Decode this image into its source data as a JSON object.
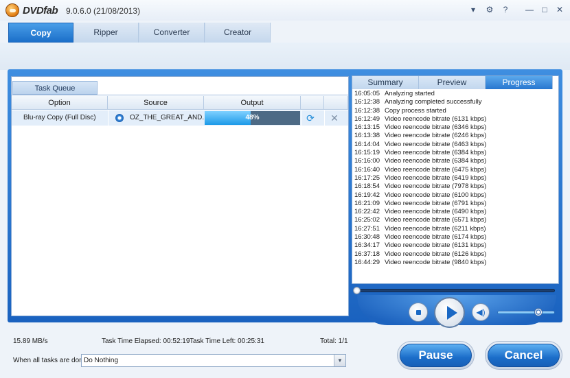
{
  "window": {
    "brand": "DVDfab",
    "version": "9.0.6.0 (21/08/2013)",
    "controls": [
      "▾",
      "⚙",
      "?",
      "—",
      "□",
      "✕"
    ]
  },
  "tabs": [
    {
      "label": "Copy",
      "active": true
    },
    {
      "label": "Ripper",
      "active": false
    },
    {
      "label": "Converter",
      "active": false
    },
    {
      "label": "Creator",
      "active": false
    }
  ],
  "queue": {
    "tab_label": "Task Queue",
    "headers": {
      "option": "Option",
      "source": "Source",
      "output": "Output"
    },
    "rows": [
      {
        "option": "Blu-ray Copy (Full Disc)",
        "source": "OZ_THE_GREAT_AND...",
        "output_progress": 48,
        "output_text": "48%"
      }
    ]
  },
  "right_tabs": [
    {
      "label": "Summary",
      "active": false
    },
    {
      "label": "Preview",
      "active": false
    },
    {
      "label": "Progress",
      "active": true
    }
  ],
  "log": [
    {
      "time": "16:05:05",
      "text": "Analyzing started"
    },
    {
      "time": "16:12:38",
      "text": "Analyzing completed successfully"
    },
    {
      "time": "16:12:38",
      "text": "Copy process started"
    },
    {
      "time": "16:12:49",
      "text": "Video reencode bitrate (6131 kbps)"
    },
    {
      "time": "16:13:15",
      "text": "Video reencode bitrate (6346 kbps)"
    },
    {
      "time": "16:13:38",
      "text": "Video reencode bitrate (6246 kbps)"
    },
    {
      "time": "16:14:04",
      "text": "Video reencode bitrate (6463 kbps)"
    },
    {
      "time": "16:15:19",
      "text": "Video reencode bitrate (6384 kbps)"
    },
    {
      "time": "16:16:00",
      "text": "Video reencode bitrate (6384 kbps)"
    },
    {
      "time": "16:16:40",
      "text": "Video reencode bitrate (6475 kbps)"
    },
    {
      "time": "16:17:25",
      "text": "Video reencode bitrate (6419 kbps)"
    },
    {
      "time": "16:18:54",
      "text": "Video reencode bitrate (7978 kbps)"
    },
    {
      "time": "16:19:42",
      "text": "Video reencode bitrate (6100 kbps)"
    },
    {
      "time": "16:21:09",
      "text": "Video reencode bitrate (6791 kbps)"
    },
    {
      "time": "16:22:42",
      "text": "Video reencode bitrate (6490 kbps)"
    },
    {
      "time": "16:25:02",
      "text": "Video reencode bitrate (6571 kbps)"
    },
    {
      "time": "16:27:51",
      "text": "Video reencode bitrate (6211 kbps)"
    },
    {
      "time": "16:30:48",
      "text": "Video reencode bitrate (6174 kbps)"
    },
    {
      "time": "16:34:17",
      "text": "Video reencode bitrate (6131 kbps)"
    },
    {
      "time": "16:37:18",
      "text": "Video reencode bitrate (6126 kbps)"
    },
    {
      "time": "16:44:29",
      "text": "Video reencode bitrate (9840 kbps)"
    }
  ],
  "player": {
    "icons": [
      "stop-icon",
      "play-icon",
      "volume-icon"
    ],
    "volume_level": 0.72,
    "seek_position": 0
  },
  "status": {
    "speed": "15.89 MB/s",
    "elapsed": "Task Time Elapsed: 00:52:19",
    "left": "Task Time Left: 00:25:31",
    "total": "Total: 1/1",
    "done_label": "When all tasks are done:",
    "done_value": "Do Nothing"
  },
  "buttons": {
    "pause": "Pause",
    "cancel": "Cancel"
  },
  "colors": {
    "accent": "#1b6fc9",
    "progress": "#1d9ae8"
  }
}
